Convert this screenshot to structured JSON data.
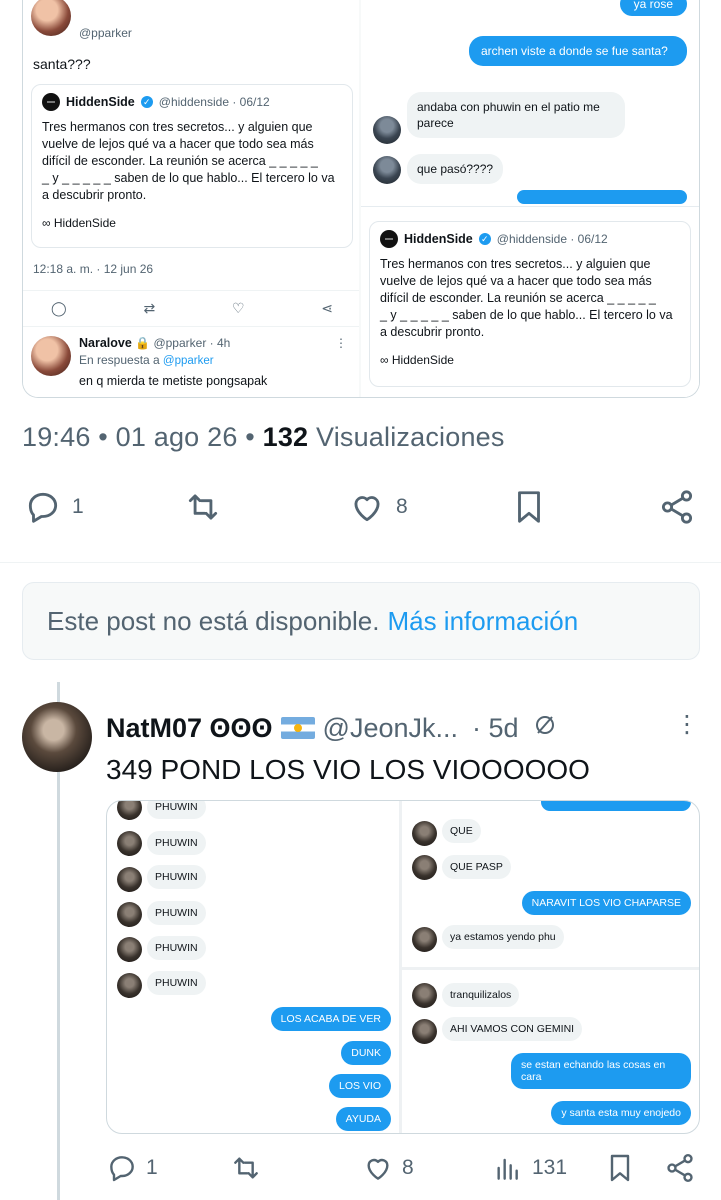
{
  "top_media": {
    "left": {
      "top_handle": "@pparker",
      "tweet_text": "santa???",
      "quote": {
        "name": "HiddenSide",
        "handle_date": "@hiddenside · 06/12",
        "body": "Tres hermanos con tres secretos... y alguien que vuelve de lejos qué va a hacer que todo sea más difícil de esconder. La reunión se acerca _ _ _ _ _\n_ y _ _ _ _ _ saben de lo que hablo... El tercero lo va a descubrir pronto.",
        "footer": "∞ HiddenSide"
      },
      "timestamp": "12:18 a. m. · 12 jun 26",
      "reply": {
        "name": "Naralove",
        "handle_time": "@pparker · 4h",
        "in_reply_prefix": "En respuesta a",
        "in_reply_handle": "@pparker",
        "text": "en q mierda te metiste pongsapak"
      }
    },
    "right": {
      "top_partial": "ya rose",
      "msg1": "archen viste a donde se fue santa?",
      "msg2": "andaba con phuwin en el patio me parece",
      "msg3": "que pasó????",
      "quote": {
        "name": "HiddenSide",
        "handle_date": "@hiddenside · 06/12",
        "body": "Tres hermanos con tres secretos... y alguien que vuelve de lejos qué va a hacer que todo sea más difícil de esconder. La reunión se acerca _ _ _ _ _\n_ y _ _ _ _ _ saben de lo que hablo... El tercero lo va a descubrir pronto.",
        "footer": "∞ HiddenSide"
      }
    }
  },
  "main_meta": {
    "time_date": "19:46 • 01 ago 26 •",
    "views_count": "132",
    "views_label": "Visualizaciones"
  },
  "main_actions": {
    "replies": "1",
    "likes": "8"
  },
  "unavailable": {
    "text": "Este post no está disponible.",
    "link": "Más información"
  },
  "reply": {
    "name": "NatM07 ʘʘʘ",
    "handle": "@JeonJk...",
    "time": "· 5d",
    "text": "349 POND LOS VIO LOS VIOOOOOO",
    "media": {
      "left_names": [
        "PHUWIN",
        "PHUWIN",
        "PHUWIN",
        "PHUWIN",
        "PHUWIN",
        "PHUWIN"
      ],
      "left_out": [
        "LOS ACABA DE VER",
        "DUNK",
        "LOS VIO",
        "AYUDA"
      ],
      "right_in_1": [
        "QUE",
        "QUE PASP"
      ],
      "right_out_1": "NARAVIT LOS VIO CHAPARSE",
      "right_in_2": "ya estamos yendo phu",
      "right_in_3": [
        "tranquilizalos",
        "AHI VAMOS CON GEMINI"
      ],
      "right_out_2": [
        "se estan echando las cosas en cara",
        "y santa esta muy enojedo"
      ]
    },
    "actions": {
      "replies": "1",
      "likes": "8",
      "views": "131"
    }
  },
  "colors": {
    "accent": "#1d9bf0",
    "muted": "#536471",
    "text": "#0f1419"
  }
}
